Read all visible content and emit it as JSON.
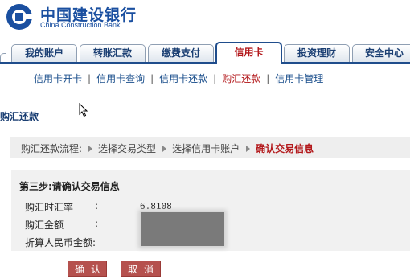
{
  "header": {
    "bank_name_cn": "中国建设银行",
    "bank_name_en": "China Construction Bank",
    "colors": {
      "brand": "#1a4fa0",
      "accent": "#b3191c"
    }
  },
  "tabs": [
    {
      "label": "我的账户",
      "active": false
    },
    {
      "label": "转账汇款",
      "active": false
    },
    {
      "label": "缴费支付",
      "active": false
    },
    {
      "label": "信用卡",
      "active": true
    },
    {
      "label": "投资理财",
      "active": false
    },
    {
      "label": "安全中心",
      "active": false
    }
  ],
  "subnav": {
    "items": [
      {
        "label": "信用卡开卡",
        "active": false
      },
      {
        "label": "信用卡查询",
        "active": false
      },
      {
        "label": "信用卡还款",
        "active": false
      },
      {
        "label": "购汇还款",
        "active": true
      },
      {
        "label": "信用卡管理",
        "active": false
      }
    ],
    "separator": "|"
  },
  "section_title": "购汇还款",
  "breadcrumb": {
    "prefix": "购汇还款流程:",
    "steps": [
      "选择交易类型",
      "选择信用卡账户",
      "确认交易信息"
    ]
  },
  "confirm": {
    "title": "第三步:请确认交易信息",
    "rows": [
      {
        "label": "购汇时汇率",
        "colon": ":",
        "value": "6.8108"
      },
      {
        "label": "购汇金额",
        "colon": ":",
        "value": ""
      },
      {
        "label": "折算人民币金额:",
        "colon": "",
        "value": ""
      }
    ]
  },
  "buttons": {
    "confirm": "确认",
    "cancel": "取消"
  }
}
